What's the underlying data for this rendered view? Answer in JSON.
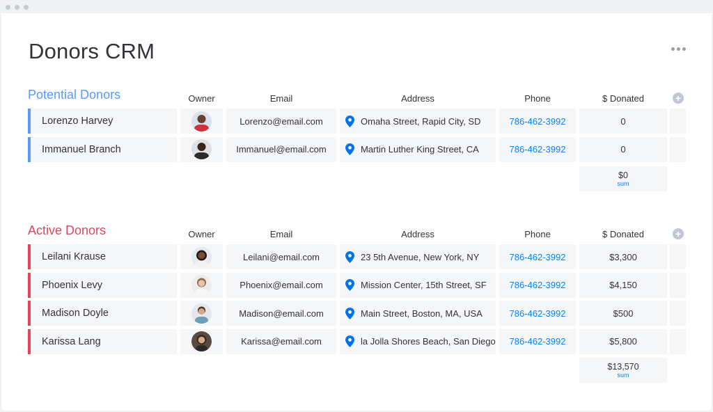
{
  "board": {
    "title": "Donors CRM"
  },
  "columns": {
    "owner": "Owner",
    "email": "Email",
    "address": "Address",
    "phone": "Phone",
    "donated": "$ Donated"
  },
  "colors": {
    "potential": "#579bfc",
    "active": "#e2445c",
    "link": "#0085ff"
  },
  "groups": [
    {
      "title": "Potential Donors",
      "color": "#579bfc",
      "rows": [
        {
          "name": "Lorenzo Harvey",
          "email": "Lorenzo@email.com",
          "address": "Omaha Street, Rapid City, SD",
          "phone": "786-462-3992",
          "donated": "0"
        },
        {
          "name": "Immanuel Branch",
          "email": "Immanuel@email.com",
          "address": "Martin Luther King Street, CA",
          "phone": "786-462-3992",
          "donated": "0"
        }
      ],
      "sum": {
        "value": "$0",
        "label": "sum"
      }
    },
    {
      "title": "Active Donors",
      "color": "#e2445c",
      "rows": [
        {
          "name": "Leilani Krause",
          "email": "Leilani@email.com",
          "address": "23 5th Avenue, New York, NY",
          "phone": "786-462-3992",
          "donated": "$3,300"
        },
        {
          "name": "Phoenix Levy",
          "email": "Phoenix@email.com",
          "address": "Mission Center, 15th Street, SF",
          "phone": "786-462-3992",
          "donated": "$4,150"
        },
        {
          "name": "Madison Doyle",
          "email": "Madison@email.com",
          "address": "Main Street, Boston, MA, USA",
          "phone": "786-462-3992",
          "donated": "$500"
        },
        {
          "name": "Karissa Lang",
          "email": "Karissa@email.com",
          "address": "la Jolla Shores Beach, San Diego",
          "phone": "786-462-3992",
          "donated": "$5,800"
        }
      ],
      "sum": {
        "value": "$13,570",
        "label": "sum"
      }
    }
  ],
  "icons": {
    "more": "more-horizontal-icon",
    "add_column": "plus-circle-icon",
    "location": "location-pin-icon"
  }
}
